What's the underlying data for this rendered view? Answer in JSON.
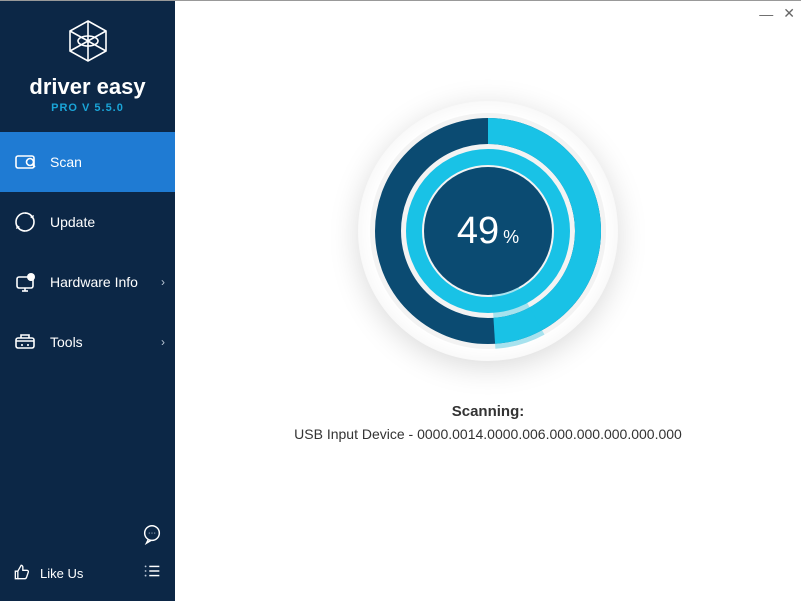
{
  "brand": {
    "name": "driver easy",
    "version": "PRO V 5.5.0"
  },
  "sidebar": {
    "items": [
      {
        "label": "Scan",
        "icon": "scan",
        "active": true,
        "submenu": false
      },
      {
        "label": "Update",
        "icon": "update",
        "active": false,
        "submenu": false
      },
      {
        "label": "Hardware Info",
        "icon": "hardware",
        "active": false,
        "submenu": true
      },
      {
        "label": "Tools",
        "icon": "tools",
        "active": false,
        "submenu": true
      }
    ],
    "likeus": "Like Us"
  },
  "scan": {
    "progress_percent": 49,
    "percent_symbol": "%",
    "status_title": "Scanning:",
    "status_detail": "USB Input Device - 0000.0014.0000.006.000.000.000.000.000"
  },
  "window_controls": {
    "minimize": "—",
    "close": "✕"
  },
  "colors": {
    "sidebar_bg": "#0c2746",
    "accent": "#1f7bd3",
    "ring_dark": "#0b4b72",
    "ring_light": "#19c2e6"
  }
}
